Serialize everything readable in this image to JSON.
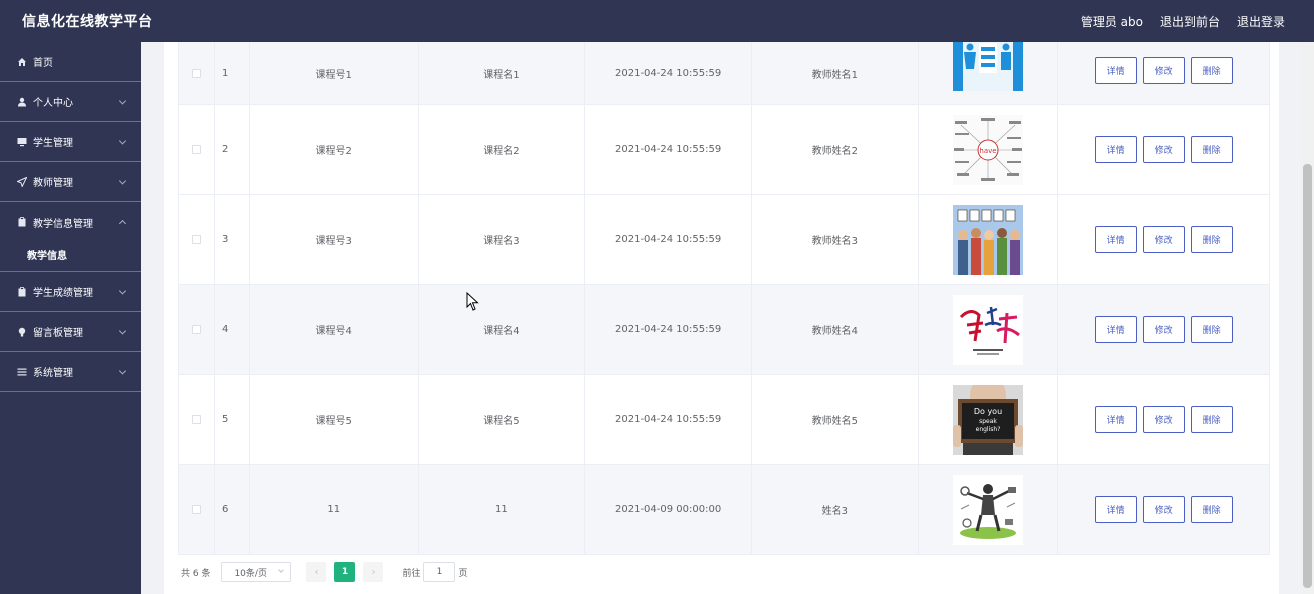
{
  "header": {
    "title": "信息化在线教学平台",
    "admin": "管理员 abo",
    "to_front": "退出到前台",
    "logout": "退出登录"
  },
  "sidebar": {
    "items": [
      {
        "label": "首页",
        "icon": "home-icon"
      },
      {
        "label": "个人中心",
        "icon": "user-icon"
      },
      {
        "label": "学生管理",
        "icon": "monitor-icon"
      },
      {
        "label": "教师管理",
        "icon": "send-icon"
      },
      {
        "label": "教学信息管理",
        "icon": "clipboard-icon",
        "expanded": true
      },
      {
        "label": "学生成绩管理",
        "icon": "clipboard-icon"
      },
      {
        "label": "留言板管理",
        "icon": "bulb-icon"
      },
      {
        "label": "系统管理",
        "icon": "list-icon"
      }
    ],
    "sub_item": "教学信息"
  },
  "table": {
    "rows": [
      {
        "index": "1",
        "code": "课程号1",
        "name": "课程名1",
        "time": "2021-04-24 10:55:59",
        "teacher": "教师姓名1"
      },
      {
        "index": "2",
        "code": "课程号2",
        "name": "课程名2",
        "time": "2021-04-24 10:55:59",
        "teacher": "教师姓名2"
      },
      {
        "index": "3",
        "code": "课程号3",
        "name": "课程名3",
        "time": "2021-04-24 10:55:59",
        "teacher": "教师姓名3"
      },
      {
        "index": "4",
        "code": "课程号4",
        "name": "课程名4",
        "time": "2021-04-24 10:55:59",
        "teacher": "教师姓名4"
      },
      {
        "index": "5",
        "code": "课程号5",
        "name": "课程名5",
        "time": "2021-04-24 10:55:59",
        "teacher": "教师姓名5"
      },
      {
        "index": "6",
        "code": "11",
        "name": "11",
        "time": "2021-04-09 00:00:00",
        "teacher": "姓名3"
      }
    ],
    "actions": {
      "detail": "详情",
      "edit": "修改",
      "delete": "删除"
    }
  },
  "pagination": {
    "total": "共 6 条",
    "page_size": "10条/页",
    "current_page": "1",
    "goto_prefix": "前往",
    "goto_value": "1",
    "goto_suffix": "页",
    "prev": "‹",
    "next": "›"
  }
}
